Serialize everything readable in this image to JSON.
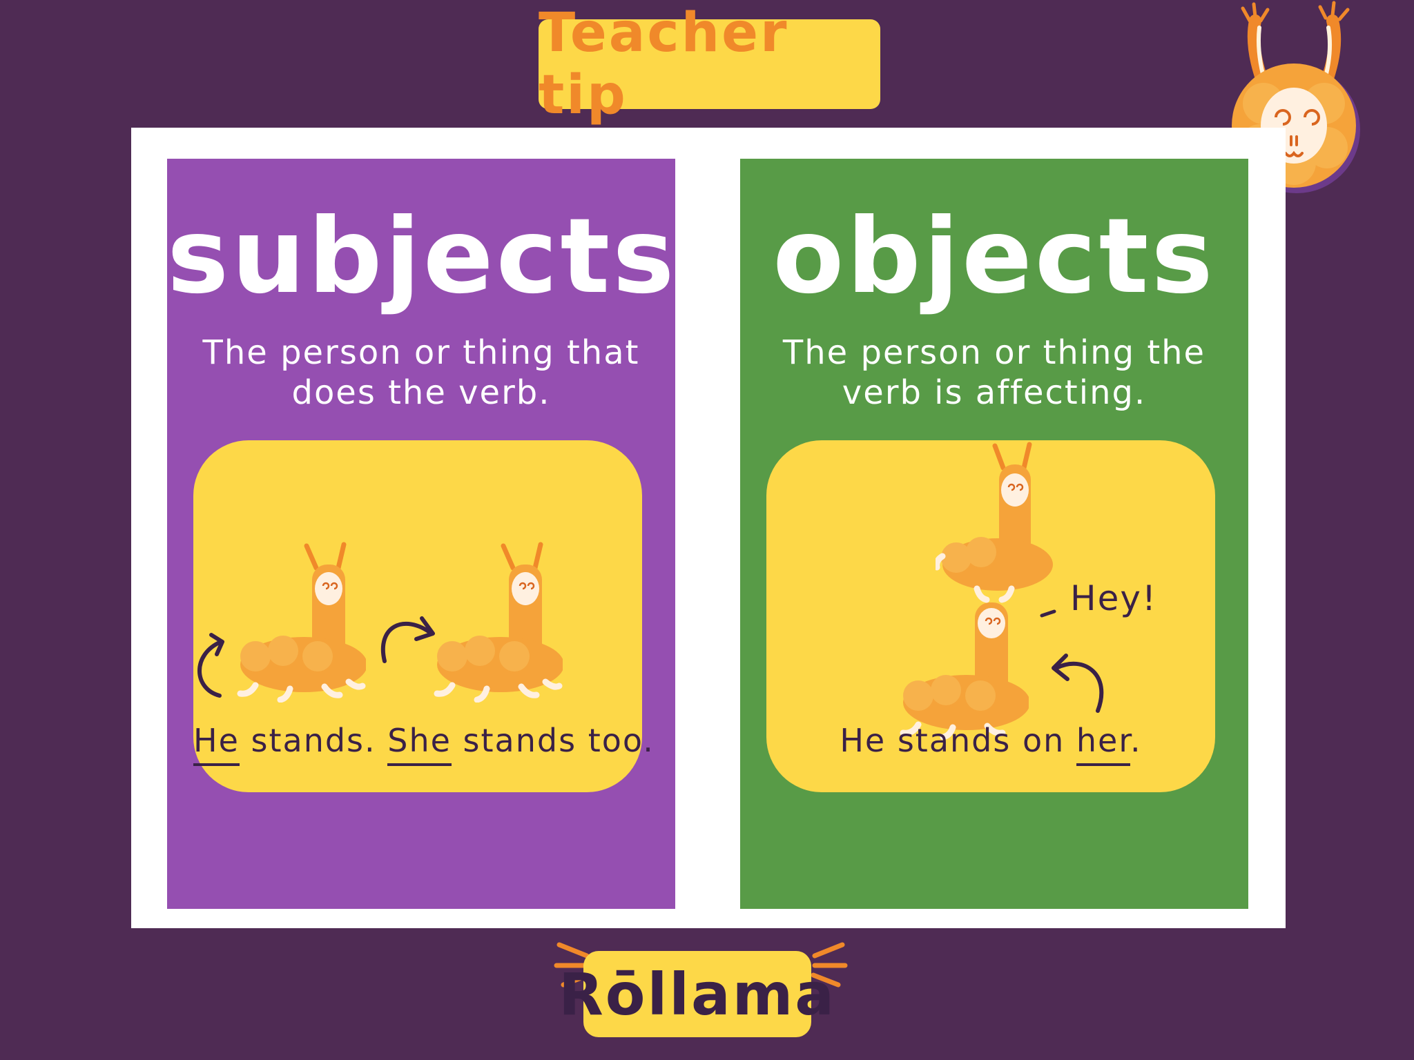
{
  "header": {
    "label": "Teacher tip"
  },
  "subjects_card": {
    "title": "subjects",
    "definition_line1": "The person or thing that",
    "definition_line2": "does the verb.",
    "example": {
      "he": "He",
      "stands1": " stands. ",
      "she": "She",
      "stands2": " stands too."
    }
  },
  "objects_card": {
    "title": "objects",
    "definition_line1": "The person or thing the",
    "definition_line2": "verb is affecting.",
    "example": {
      "exclamation": "Hey!",
      "before": "He stands on ",
      "her": "her",
      "after": "."
    }
  },
  "brand": {
    "name": "Rōllama"
  },
  "colors": {
    "background": "#4f2b54",
    "subjects_card": "#954fb1",
    "objects_card": "#589b47",
    "panel": "#fdd848",
    "accent_orange": "#f0892a",
    "ink": "#3a2147"
  }
}
